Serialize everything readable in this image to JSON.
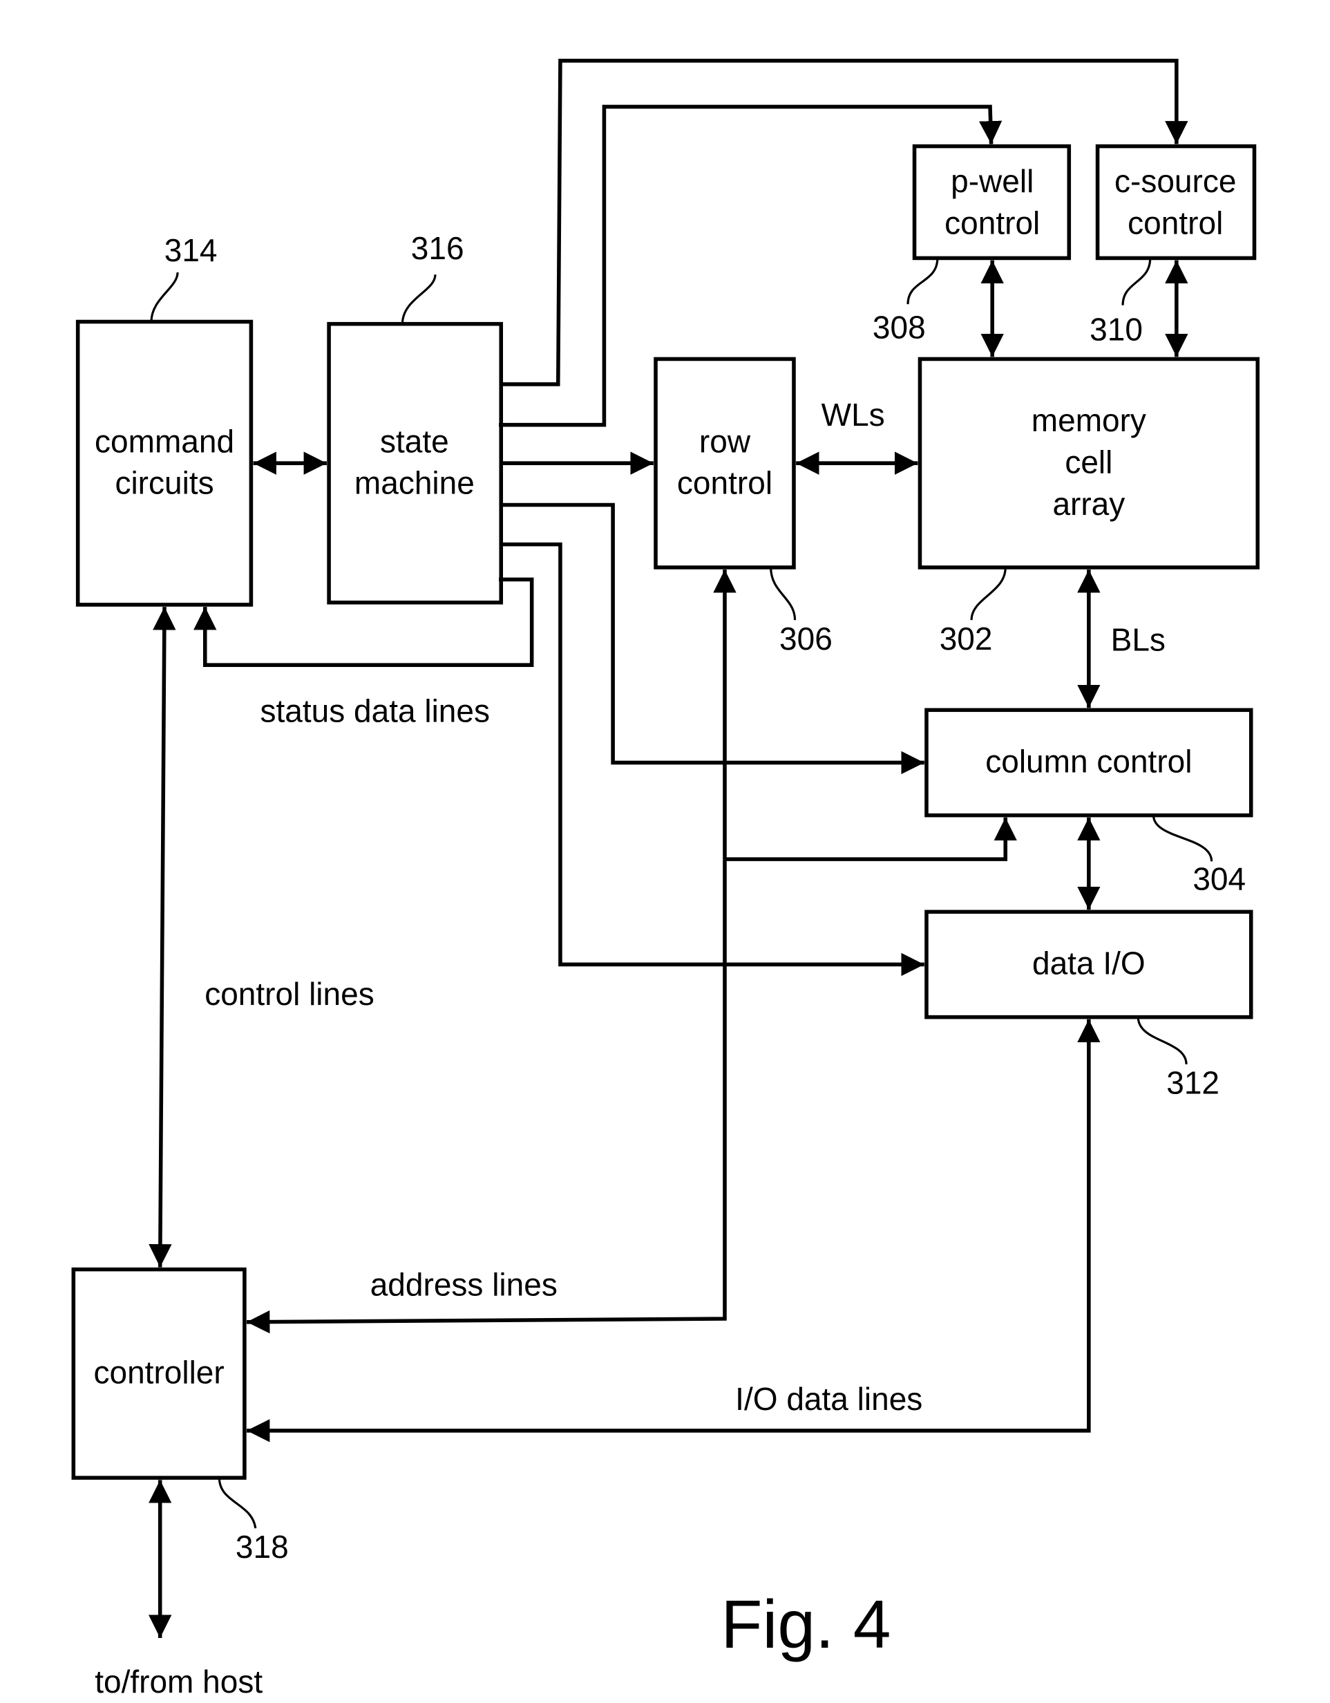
{
  "figure": {
    "title": "Fig. 4"
  },
  "blocks": {
    "command_circuits": {
      "lines": [
        "command",
        "circuits"
      ],
      "ref": "314"
    },
    "state_machine": {
      "lines": [
        "state",
        "machine"
      ],
      "ref": "316"
    },
    "row_control": {
      "lines": [
        "row",
        "control"
      ],
      "ref": "306"
    },
    "memory_cell_array": {
      "lines": [
        "memory",
        "cell",
        "array"
      ],
      "ref": "302"
    },
    "p_well_control": {
      "lines": [
        "p-well",
        "control"
      ],
      "ref": "308"
    },
    "c_source_control": {
      "lines": [
        "c-source",
        "control"
      ],
      "ref": "310"
    },
    "column_control": {
      "lines": [
        "column control"
      ],
      "ref": "304"
    },
    "data_io": {
      "lines": [
        "data I/O"
      ],
      "ref": "312"
    },
    "controller": {
      "lines": [
        "controller"
      ],
      "ref": "318"
    }
  },
  "signals": {
    "wls": "WLs",
    "bls": "BLs",
    "status_data_lines": "status data lines",
    "control_lines": "control lines",
    "address_lines": "address lines",
    "io_data_lines": "I/O data lines",
    "host": "to/from host"
  }
}
